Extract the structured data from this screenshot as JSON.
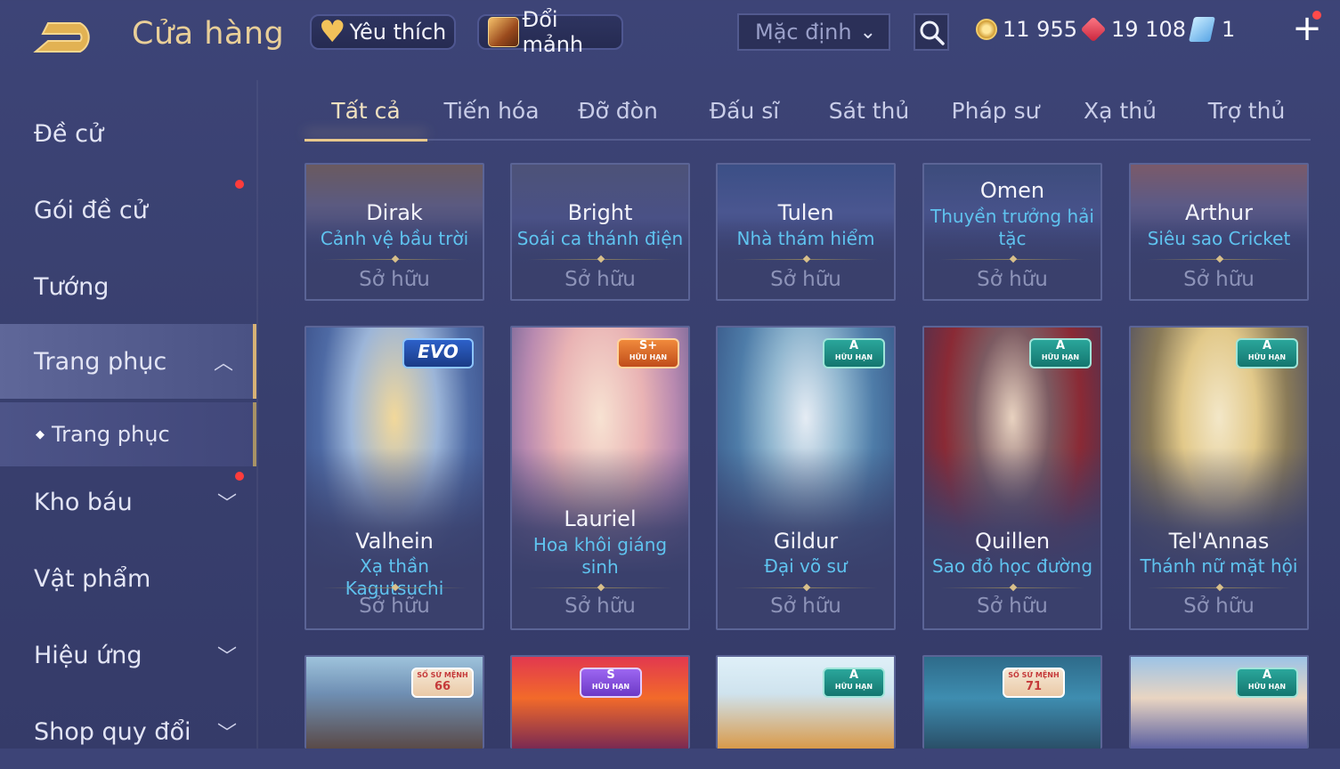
{
  "header": {
    "title": "Cửa hàng",
    "favorites_label": "Yêu thích",
    "exchange_label": "Đổi mảnh",
    "sort_value": "Mặc định"
  },
  "currency": {
    "gold": "11 955",
    "ruby": "19 108",
    "voucher": "1"
  },
  "sidebar": {
    "items": [
      {
        "label": "Đề cử"
      },
      {
        "label": "Gói đề cử"
      },
      {
        "label": "Tướng"
      },
      {
        "label": "Trang phục"
      },
      {
        "label": "Trang phục"
      },
      {
        "label": "Kho báu"
      },
      {
        "label": "Vật phẩm"
      },
      {
        "label": "Hiệu ứng"
      },
      {
        "label": "Shop quy đổi"
      }
    ]
  },
  "tabs": [
    "Tất cả",
    "Tiến hóa",
    "Đỡ đòn",
    "Đấu sĩ",
    "Sát thủ",
    "Pháp sư",
    "Xạ thủ",
    "Trợ thủ"
  ],
  "row1": [
    {
      "hero": "Dirak",
      "skin": "Cảnh vệ bầu trời",
      "status": "Sở hữu"
    },
    {
      "hero": "Bright",
      "skin": "Soái ca thánh điện",
      "status": "Sở hữu"
    },
    {
      "hero": "Tulen",
      "skin": "Nhà thám hiểm",
      "status": "Sở hữu"
    },
    {
      "hero": "Omen",
      "skin": "Thuyền trưởng hải tặc",
      "status": "Sở hữu"
    },
    {
      "hero": "Arthur",
      "skin": "Siêu sao Cricket",
      "status": "Sở hữu"
    }
  ],
  "row2": [
    {
      "hero": "Valhein",
      "skin": "Xạ thần Kagutsuchi",
      "status": "Sở hữu",
      "badge": "EVO"
    },
    {
      "hero": "Lauriel",
      "skin": "Hoa khôi giáng sinh",
      "status": "Sở hữu",
      "badge": "S+",
      "badge_sub": "HỮU HẠN"
    },
    {
      "hero": "Gildur",
      "skin": "Đại võ sư",
      "status": "Sở hữu",
      "badge": "A",
      "badge_sub": "HỮU HẠN"
    },
    {
      "hero": "Quillen",
      "skin": "Sao đỏ học đường",
      "status": "Sở hữu",
      "badge": "A",
      "badge_sub": "HỮU HẠN"
    },
    {
      "hero": "Tel'Annas",
      "skin": "Thánh nữ mặt hội",
      "status": "Sở hữu",
      "badge": "A",
      "badge_sub": "HỮU HẠN"
    }
  ],
  "row3": [
    {
      "badge": "66",
      "badge_sub": "SỐ SỨ MỆNH"
    },
    {
      "badge": "S",
      "badge_sub": "HỮU HẠN"
    },
    {
      "badge": "A",
      "badge_sub": "HỮU HẠN"
    },
    {
      "badge": "71",
      "badge_sub": "SỐ SỨ MỆNH"
    },
    {
      "badge": "A",
      "badge_sub": "HỮU HẠN"
    }
  ],
  "colors": {
    "accent_gold": "#e9cf98",
    "skin_name_blue": "#5fc3ef",
    "notification_red": "#ff3c3c"
  }
}
